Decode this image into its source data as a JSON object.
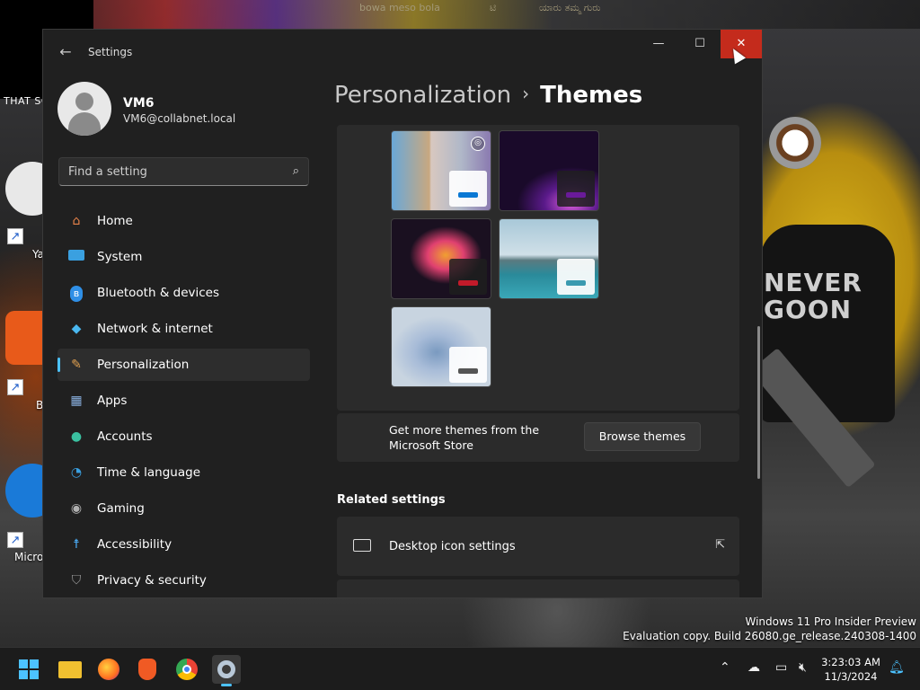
{
  "desktop": {
    "top_banner_left_text": "THAT SC",
    "top_strip_texts": [
      "bowa meso bola",
      "ಟಿ",
      "ಯಾರು ತಮ್ಮ ಗುರು"
    ],
    "icons": [
      {
        "label": "Ya"
      },
      {
        "label": "B"
      },
      {
        "label": "Micro"
      }
    ],
    "wallpaper_text": "NEVER GOON",
    "watermark_line1": "Windows 11 Pro Insider Preview",
    "watermark_line2": "Evaluation copy. Build 26080.ge_release.240308-1400"
  },
  "window": {
    "app_title": "Settings",
    "back_label": "←",
    "controls": {
      "minimize": "—",
      "maximize": "☐",
      "close": "✕"
    }
  },
  "profile": {
    "name": "VM6",
    "email": "VM6@collabnet.local"
  },
  "search": {
    "placeholder": "Find a setting",
    "icon": "search-icon"
  },
  "sidebar": {
    "items": [
      {
        "label": "Home",
        "icon": "home-icon",
        "color": "#e8834a"
      },
      {
        "label": "System",
        "icon": "monitor-icon",
        "color": "#3aa0e0"
      },
      {
        "label": "Bluetooth & devices",
        "icon": "bluetooth-icon",
        "color": "#2f8fe6"
      },
      {
        "label": "Network & internet",
        "icon": "wifi-icon",
        "color": "#4ab8f0"
      },
      {
        "label": "Personalization",
        "icon": "brush-icon",
        "color": "#e0a050",
        "active": true
      },
      {
        "label": "Apps",
        "icon": "apps-icon",
        "color": "#8ab0e0"
      },
      {
        "label": "Accounts",
        "icon": "person-icon",
        "color": "#3ac0a0"
      },
      {
        "label": "Time & language",
        "icon": "clock-globe-icon",
        "color": "#3aa0e0"
      },
      {
        "label": "Gaming",
        "icon": "gamepad-icon",
        "color": "#b0b0b0"
      },
      {
        "label": "Accessibility",
        "icon": "accessibility-icon",
        "color": "#4aa8f0"
      },
      {
        "label": "Privacy & security",
        "icon": "shield-icon",
        "color": "#9a9a9a"
      }
    ]
  },
  "main": {
    "breadcrumb_parent": "Personalization",
    "breadcrumb_sep": "›",
    "breadcrumb_current": "Themes",
    "themes": [
      {
        "name": "theme-1",
        "accent": "#0a78d4",
        "preview": "light",
        "badge": true
      },
      {
        "name": "theme-2",
        "accent": "#6a1a9a",
        "preview": "dark"
      },
      {
        "name": "theme-3",
        "accent": "#c21a2a",
        "preview": "dark"
      },
      {
        "name": "theme-4",
        "accent": "#3a9ab0",
        "preview": "light"
      },
      {
        "name": "theme-5",
        "accent": "#555555",
        "preview": "light"
      }
    ],
    "store_text": "Get more themes from the Microsoft Store",
    "browse_button": "Browse themes",
    "related_title": "Related settings",
    "related_items": [
      {
        "label": "Desktop icon settings"
      }
    ]
  },
  "taskbar": {
    "apps": [
      "start-button",
      "file-explorer",
      "firefox",
      "brave",
      "chrome",
      "settings"
    ],
    "time": "3:23:03 AM",
    "date": "11/3/2024"
  }
}
